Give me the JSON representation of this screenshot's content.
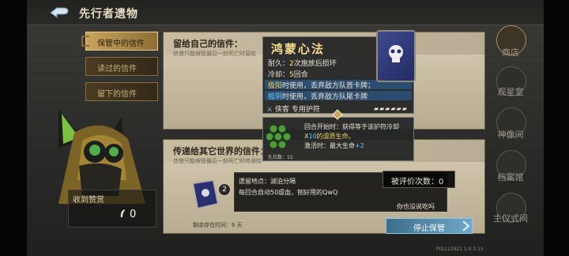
{
  "header": {
    "title": "先行者遗物"
  },
  "tabs": [
    {
      "label": "保管中的信件"
    },
    {
      "label": "读过的信件"
    },
    {
      "label": "留下的信件"
    }
  ],
  "left": {
    "received_label": "收到赞赏",
    "received_count": "0"
  },
  "panel_top": {
    "title": "留给自己的信件：",
    "subtitle": "信使只能保管最后一封死亡时留给"
  },
  "panel_bottom": {
    "title": "传递给其它世界的信件：",
    "subtitle": "信使只能保管最后一封死亡时传递给",
    "location": "遗留地点：湖泊分隔",
    "message": "每回合自动50虐血，刨好用的QwQ",
    "remaining": "剩余存在时间：6 天",
    "card_level": "2"
  },
  "tooltip": {
    "title": "鸿蒙心法",
    "durability_label": "耐久：",
    "durability_value": "2",
    "durability_suffix": "次施放后损坏",
    "cooldown_label": "冷却：",
    "cooldown_value": "5",
    "cooldown_suffix": "回合",
    "yang_label": "极阳",
    "yang_text": "时使用，丢弃敌方队首卡牌；",
    "yin_label": "极阴",
    "yin_text": "时使用，丢弃敌方队尾卡牌",
    "tag": "侠客 专用护符"
  },
  "section": {
    "line1": "回合开始时：获得等于该护符冷却",
    "line2_pre": "X",
    "line2_num": "10",
    "line2_post": "的虐质生命。",
    "line3_pre": "激活时：最大生命",
    "line3_num": "+2",
    "value_label": "孔位数：15"
  },
  "rating": {
    "label": "被评价次数：",
    "value": "0"
  },
  "prompt": "你也没说吃吗",
  "stop_button": "停止保管",
  "version": "PID112821  1.0.3.13",
  "nav": [
    {
      "label": "商店"
    },
    {
      "label": "观星室"
    },
    {
      "label": "神像间"
    },
    {
      "label": "档案馆"
    },
    {
      "label": "主仪式间"
    }
  ],
  "colors": {
    "accent_gold": "#c9a45c",
    "tooltip_bg": "#262828",
    "stop_button": "#6fa8c9"
  }
}
